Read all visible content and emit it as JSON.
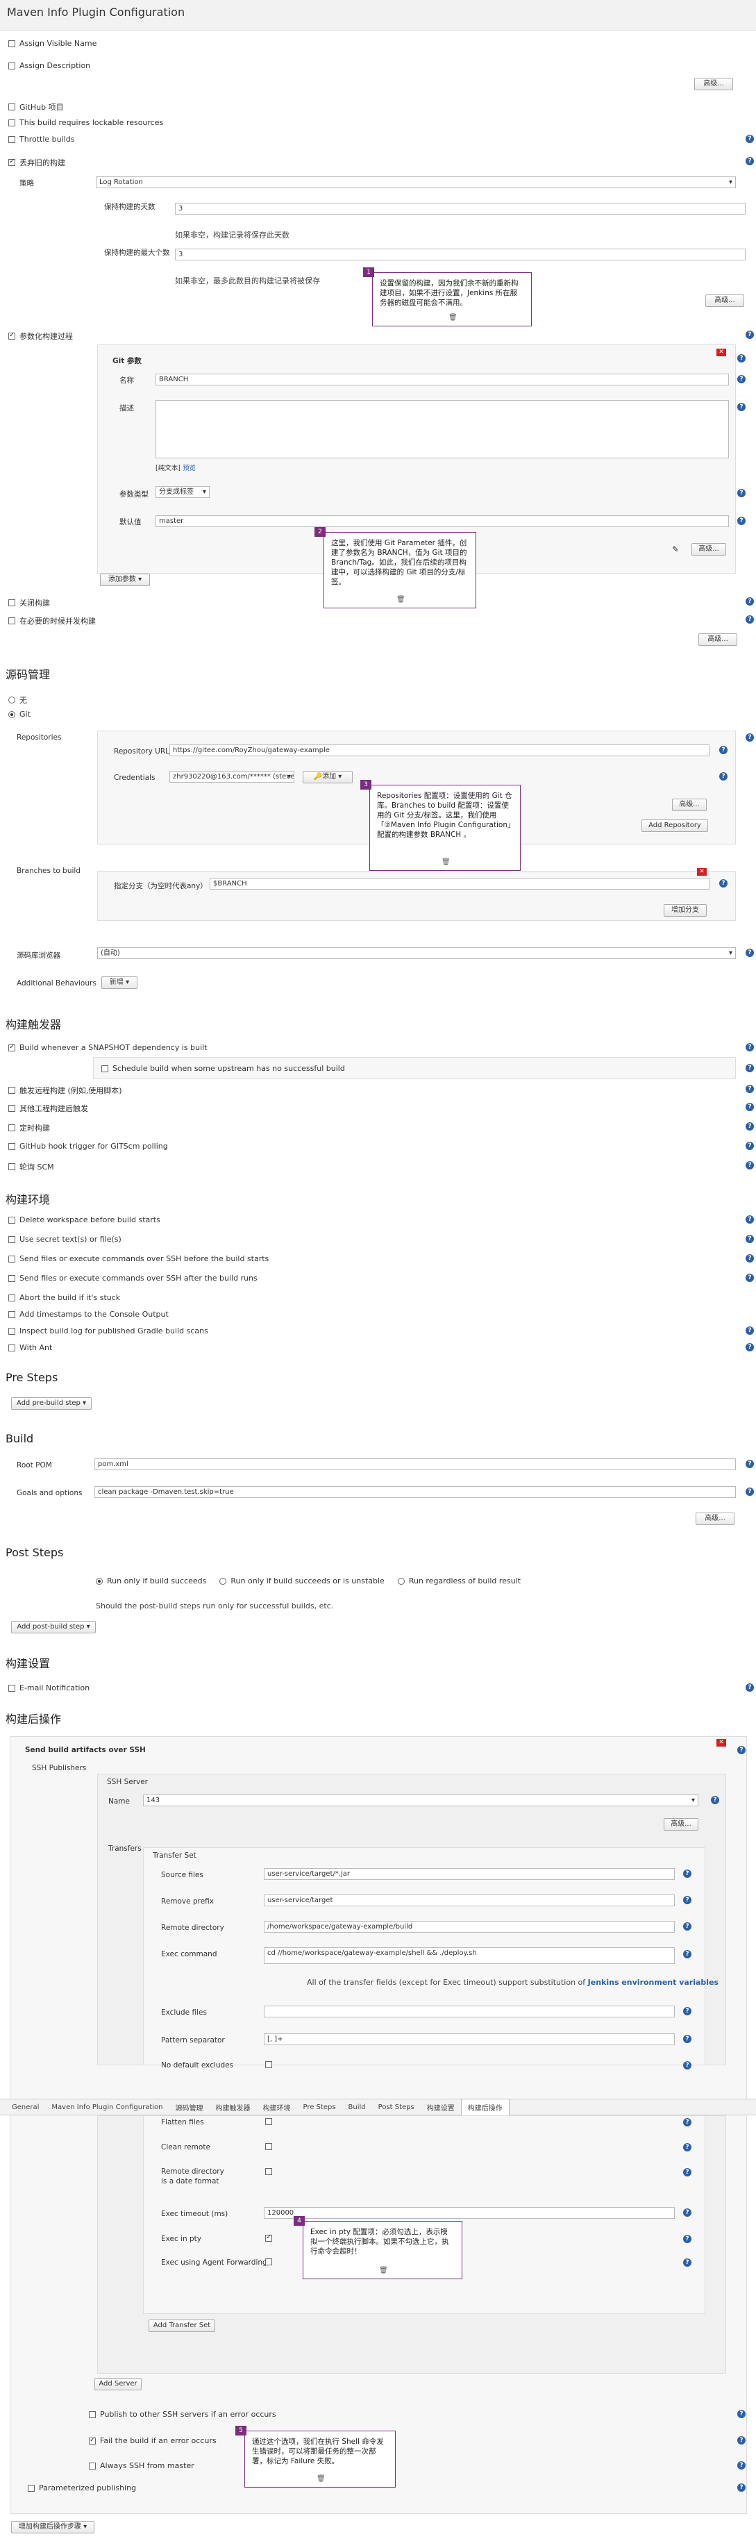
{
  "header": {
    "title": "Maven Info Plugin Configuration"
  },
  "general": {
    "assign_visible_name": "Assign Visible Name",
    "assign_description": "Assign Description",
    "advanced": "高级...",
    "github_project": "GitHub 项目",
    "lockable": "This build requires lockable resources",
    "throttle": "Throttle builds",
    "discard_old": "丢弃旧的构建",
    "strategy_label": "策略",
    "strategy_value": "Log Rotation",
    "days_label": "保持构建的天数",
    "days_value": "3",
    "days_hint": "如果非空，构建记录将保存此天数",
    "max_label": "保持构建的最大个数",
    "max_value": "3",
    "max_hint": "如果非空，最多此数目的构建记录将被保存",
    "parameterized": "参数化构建过程",
    "disable_build": "关闭构建",
    "concurrent": "在必要的时候并发构建"
  },
  "param": {
    "title": "Git 参数",
    "name_label": "名称",
    "name_value": "BRANCH",
    "desc_label": "描述",
    "plain_text": "[纯文本]",
    "preview": "预览",
    "type_label": "参数类型",
    "type_value": "分支或标签",
    "default_label": "默认值",
    "default_value": "master",
    "add_param": "添加参数 ▾"
  },
  "scm": {
    "title": "源码管理",
    "none": "无",
    "git": "Git",
    "repos_label": "Repositories",
    "url_label": "Repository URL",
    "url_value": "https://gitee.com/RoyZhou/gateway-example",
    "cred_label": "Credentials",
    "cred_value": "zhr930220@163.com/****** (steve)",
    "add_cred": "🔑添加 ▾",
    "advanced": "高级...",
    "add_repo": "Add Repository",
    "branches_label": "Branches to build",
    "spec_label": "指定分支（为空时代表any）",
    "spec_value": "$BRANCH",
    "add_branch": "增加分支",
    "browser_label": "源码库浏览器",
    "browser_value": "(自动)",
    "behaviours_label": "Additional Behaviours",
    "new": "新增 ▾"
  },
  "triggers": {
    "title": "构建触发器",
    "snapshot": "Build whenever a SNAPSHOT dependency is built",
    "schedule": "Schedule build when some upstream has no successful build",
    "remote": "触发远程构建 (例如,使用脚本)",
    "after_other": "其他工程构建后触发",
    "periodic": "定时构建",
    "github_hook": "GitHub hook trigger for GITScm polling",
    "poll_scm": "轮询 SCM"
  },
  "env": {
    "title": "构建环境",
    "delete_ws": "Delete workspace before build starts",
    "secret": "Use secret text(s) or file(s)",
    "ssh_before": "Send files or execute commands over SSH before the build starts",
    "ssh_after": "Send files or execute commands over SSH after the build runs",
    "abort": "Abort the build if it's stuck",
    "timestamps": "Add timestamps to the Console Output",
    "gradle": "Inspect build log for published Gradle build scans",
    "ant": "With Ant"
  },
  "pre": {
    "title": "Pre Steps",
    "add": "Add pre-build step ▾"
  },
  "build": {
    "title": "Build",
    "pom_label": "Root POM",
    "pom_value": "pom.xml",
    "goals_label": "Goals and options",
    "goals_value": "clean package -Dmaven.test.skip=true",
    "advanced": "高级..."
  },
  "post": {
    "title": "Post Steps",
    "run_success": "Run only if build succeeds",
    "run_unstable": "Run only if build succeeds or is unstable",
    "run_regardless": "Run regardless of build result",
    "hint": "Should the post-build steps run only for successful builds, etc.",
    "add": "Add post-build step ▾"
  },
  "settings": {
    "title": "构建设置",
    "email": "E-mail Notification"
  },
  "postbuild": {
    "title": "构建后操作",
    "send": "Send build artifacts over SSH",
    "publishers": "SSH Publishers",
    "server": "SSH Server",
    "name_label": "Name",
    "name_value": "143",
    "advanced": "高级...",
    "transfers": "Transfers",
    "transfer_set": "Transfer Set",
    "source_label": "Source files",
    "source_value": "user-service/target/*.jar",
    "prefix_label": "Remove prefix",
    "prefix_value": "user-service/target",
    "remote_label": "Remote directory",
    "remote_value": "/home/workspace/gateway-example/build",
    "exec_label": "Exec command",
    "exec_value": "cd //home/workspace/gateway-example/shell && ./deploy.sh",
    "subst_text": "All of the transfer fields (except for Exec timeout) support substitution of",
    "subst_link": "Jenkins environment variables",
    "exclude_label": "Exclude files",
    "pattern_label": "Pattern separator",
    "pattern_value": "[, ]+",
    "no_default": "No default excludes",
    "flatten": "Flatten files",
    "clean": "Clean remote",
    "date_dir": "Remote directory is a date format",
    "timeout_label": "Exec timeout (ms)",
    "timeout_value": "120000",
    "pty": "Exec in pty",
    "agent": "Exec using Agent Forwarding",
    "add_transfer": "Add Transfer Set",
    "add_server": "Add Server",
    "publish_other": "Publish to other SSH servers if an error occurs",
    "fail_build": "Fail the build if an error occurs",
    "always_master": "Always SSH from master",
    "parameterized": "Parameterized publishing",
    "add_step": "增加构建后操作步骤 ▾"
  },
  "tabs": [
    "General",
    "Maven Info Plugin Configuration",
    "源码管理",
    "构建触发器",
    "构建环境",
    "Pre Steps",
    "Build",
    "Post Steps",
    "构建设置",
    "构建后操作"
  ],
  "callouts": {
    "c1_num": "1",
    "c1": "设置保留的构建，因为我们余不新的重新构建项目，如果不进行设置，Jenkins 所在服务器的磁盘可能会不满用。",
    "c2_num": "2",
    "c2": "这里，我们使用 Git Parameter 插件，创建了参数名为 BRANCH，值为 Git 项目的 Branch/Tag。如此，我们在后续的项目构建中，可以选择构建的 Git 项目的分支/标签。",
    "c3_num": "3",
    "c3": "Repositories 配置项：设置使用的 Git 仓库。Branches to build 配置项：设置使用的 Git 分支/标签。这里，我们使用「②Maven Info Plugin Configuration」配置的构建参数 BRANCH 。",
    "c4_num": "4",
    "c4": "Exec in pty 配置项：必须勾选上，表示模拟一个终端执行脚本。如果不勾选上它，执行命令会超时！",
    "c5_num": "5",
    "c5": "通过这个选项，我们在执行 Shell 命令发生错误时，可以将那最任务的整一次部署，标记为 Failure 失败。"
  },
  "colors": {
    "accent": "#2b60a8",
    "callout": "#7b2d80",
    "delete": "#d32020"
  }
}
